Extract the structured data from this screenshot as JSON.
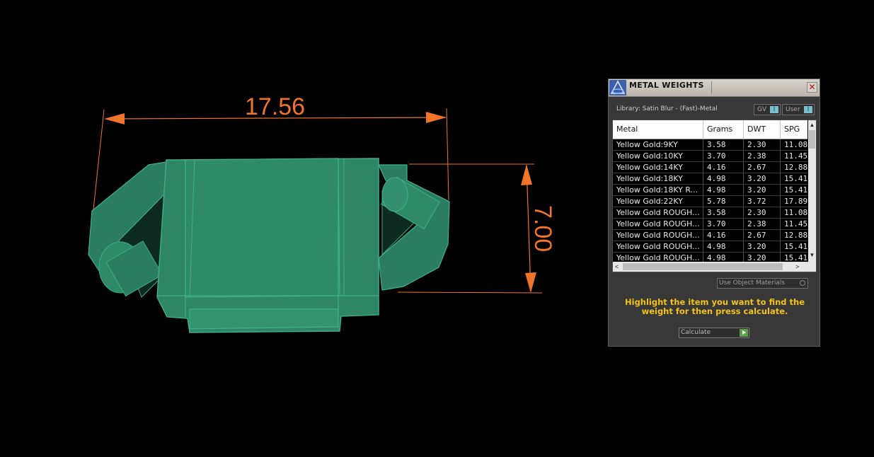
{
  "viewport": {
    "dimension_width": "17.56",
    "dimension_height": "7.00",
    "colors": {
      "dimension": "#f0742a",
      "model": "#2f8a6a",
      "background": "#000000"
    }
  },
  "panel": {
    "title": "METAL WEIGHTS",
    "close_icon": "✕",
    "library_label": "Library: Satin Blur - (Fast)-Metal",
    "gv_toggle": {
      "label": "GV",
      "knob": "I"
    },
    "user_toggle": {
      "label": "User",
      "knob": "I"
    },
    "table": {
      "columns": [
        "Metal",
        "Grams",
        "DWT",
        "SPG"
      ],
      "rows": [
        [
          "Yellow Gold:9KY",
          "3.58",
          "2.30",
          "11.08"
        ],
        [
          "Yellow Gold:10KY",
          "3.70",
          "2.38",
          "11.45"
        ],
        [
          "Yellow Gold:14KY",
          "4.16",
          "2.67",
          "12.88"
        ],
        [
          "Yellow Gold:18KY",
          "4.98",
          "3.20",
          "15.41"
        ],
        [
          "Yellow Gold:18KY R...",
          "4.98",
          "3.20",
          "15.41"
        ],
        [
          "Yellow Gold:22KY",
          "5.78",
          "3.72",
          "17.89"
        ],
        [
          "Yellow Gold ROUGH...",
          "3.58",
          "2.30",
          "11.08"
        ],
        [
          "Yellow Gold ROUGH...",
          "3.70",
          "2.38",
          "11.45"
        ],
        [
          "Yellow Gold ROUGH...",
          "4.16",
          "2.67",
          "12.88"
        ],
        [
          "Yellow Gold ROUGH...",
          "4.98",
          "3.20",
          "15.41"
        ],
        [
          "Yellow Gold ROUGH...",
          "4.98",
          "3.20",
          "15.41"
        ]
      ]
    },
    "scroll": {
      "up": "▲",
      "down": "▼",
      "left": "<",
      "right": ">"
    },
    "use_object_materials": "Use Object Materials",
    "hint": "Highlight the item you want to find the weight for then press calculate.",
    "calculate_label": "Calculate",
    "colors": {
      "hint": "#f2c418",
      "panel_bg": "#383838",
      "toggle_knob": "#7bbfcf",
      "calc_play": "#5aa04a"
    }
  }
}
